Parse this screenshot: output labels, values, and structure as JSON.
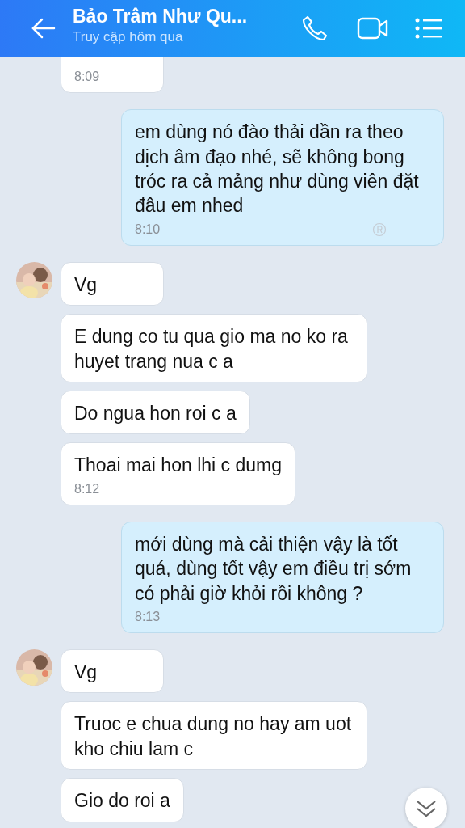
{
  "header": {
    "title": "Bảo Trâm Như Qu...",
    "subtitle": "Truy cập hôm qua"
  },
  "messages": [
    {
      "kind": "in",
      "avatar": false,
      "time": "8:09"
    },
    {
      "kind": "out",
      "avatar": false,
      "text": "em dùng nó đào thải dần ra theo dịch âm đạo nhé, sẽ không bong tróc ra cả mảng như dùng viên đặt đâu em nhed",
      "time": "8:10",
      "received": true
    },
    {
      "kind": "in",
      "avatar": true,
      "text": "Vg"
    },
    {
      "kind": "in",
      "avatar": false,
      "text": "E dung co tu qua gio ma no ko ra huyet trang nua c a"
    },
    {
      "kind": "in",
      "avatar": false,
      "text": "Do ngua hon roi c a"
    },
    {
      "kind": "in",
      "avatar": false,
      "text": "Thoai mai hon lhi c dumg",
      "time": "8:12"
    },
    {
      "kind": "out",
      "avatar": false,
      "text": "mới dùng mà cải thiện vậy là tốt quá, dùng tốt vậy em điều trị sớm có phải giờ khỏi rồi không ?",
      "time": "8:13",
      "received": false
    },
    {
      "kind": "in",
      "avatar": true,
      "text": "Vg"
    },
    {
      "kind": "in",
      "avatar": false,
      "text": "Truoc e chua dung no hay am uot kho chiu lam c"
    },
    {
      "kind": "in",
      "avatar": false,
      "text": "Gio do roi a"
    }
  ]
}
